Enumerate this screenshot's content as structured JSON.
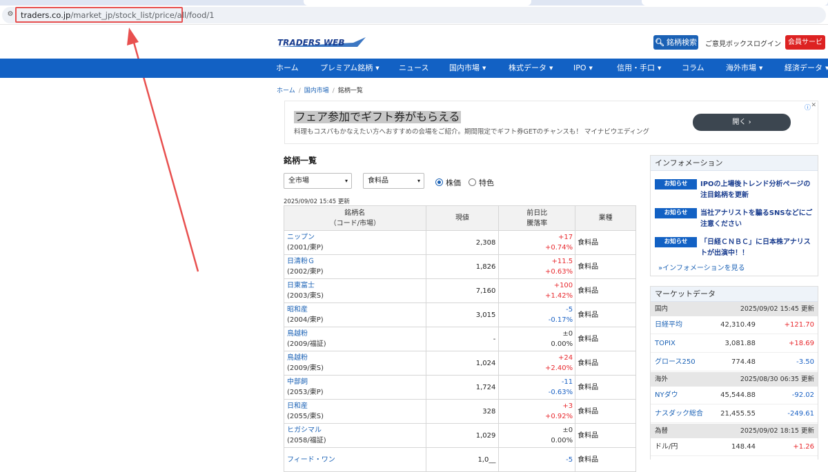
{
  "browser": {
    "url_domain": "traders.co.jp",
    "url_path": "/market_jp/stock_list/price/all/food/1"
  },
  "header": {
    "logo_text": "TRADERS WEB",
    "search_button": "銘柄検索",
    "feedback_link": "ご意見ボックス",
    "login_link": "ログイン",
    "member_button": "会員サービス"
  },
  "nav": [
    {
      "label": "ホーム",
      "caret": false
    },
    {
      "label": "プレミアム銘柄",
      "caret": true
    },
    {
      "label": "ニュース",
      "caret": false
    },
    {
      "label": "国内市場",
      "caret": true
    },
    {
      "label": "株式データ",
      "caret": true
    },
    {
      "label": "IPO",
      "caret": true
    },
    {
      "label": "信用・手口",
      "caret": true
    },
    {
      "label": "コラム",
      "caret": false
    },
    {
      "label": "海外市場",
      "caret": true
    },
    {
      "label": "経済データ",
      "caret": true
    }
  ],
  "breadcrumb": {
    "home": "ホーム",
    "domestic": "国内市場",
    "current": "銘柄一覧",
    "separator": "/"
  },
  "ad": {
    "title": "フェア参加でギフト券がもらえる",
    "description": "料理もコスパもかなえたい方へおすすめの会場をご紹介。期間限定でギフト券GETのチャンスも！ マイナビウエディング",
    "button": "開く",
    "button_icon": "chevron-right-icon",
    "info_icon": "info-icon",
    "close_icon": "close-icon"
  },
  "main": {
    "title": "銘柄一覧",
    "market_select": "全市場",
    "industry_select": "食料品",
    "radio_price": "株価",
    "radio_feature": "特色",
    "updated": "2025/09/02 15:45 更新",
    "columns": {
      "name_line1": "銘柄名",
      "name_line2": "（コード/市場）",
      "price": "現値",
      "change_line1": "前日比",
      "change_line2": "騰落率",
      "industry": "業種"
    },
    "rows": [
      {
        "name": "ニップン",
        "code": "(2001/東P)",
        "price": "2,308",
        "change": "+17",
        "pct": "+0.74%",
        "dir": "up",
        "industry": "食料品"
      },
      {
        "name": "日清粉Ｇ",
        "code": "(2002/東P)",
        "price": "1,826",
        "change": "+11.5",
        "pct": "+0.63%",
        "dir": "up",
        "industry": "食料品"
      },
      {
        "name": "日東富士",
        "code": "(2003/東S)",
        "price": "7,160",
        "change": "+100",
        "pct": "+1.42%",
        "dir": "up",
        "industry": "食料品"
      },
      {
        "name": "昭和産",
        "code": "(2004/東P)",
        "price": "3,015",
        "change": "-5",
        "pct": "-0.17%",
        "dir": "down",
        "industry": "食料品"
      },
      {
        "name": "鳥越粉",
        "code": "(2009/福証)",
        "price": "-",
        "change": "±0",
        "pct": "0.00%",
        "dir": "flat",
        "industry": "食料品"
      },
      {
        "name": "鳥越粉",
        "code": "(2009/東S)",
        "price": "1,024",
        "change": "+24",
        "pct": "+2.40%",
        "dir": "up",
        "industry": "食料品"
      },
      {
        "name": "中部飼",
        "code": "(2053/東P)",
        "price": "1,724",
        "change": "-11",
        "pct": "-0.63%",
        "dir": "down",
        "industry": "食料品"
      },
      {
        "name": "日和産",
        "code": "(2055/東S)",
        "price": "328",
        "change": "+3",
        "pct": "+0.92%",
        "dir": "up",
        "industry": "食料品"
      },
      {
        "name": "ヒガシマル",
        "code": "(2058/福証)",
        "price": "1,029",
        "change": "±0",
        "pct": "0.00%",
        "dir": "flat",
        "industry": "食料品"
      },
      {
        "name": "フィード・ワン",
        "code": "",
        "price": "1,0__",
        "change": "-5",
        "pct": "",
        "dir": "down",
        "industry": "食料品"
      }
    ]
  },
  "sidebar": {
    "info_title": "インフォメーション",
    "info_items": [
      {
        "badge": "お知らせ",
        "text": "IPOの上場後トレンド分析ページの注目銘柄を更新"
      },
      {
        "badge": "お知らせ",
        "text": "当社アナリストを騙るSNSなどにご注意ください"
      },
      {
        "badge": "お知らせ",
        "text": "「日経ＣＮＢＣ」に日本株アナリストが出演中！！"
      }
    ],
    "info_more": "»インフォメーションを見る",
    "market_title": "マーケットデータ",
    "market_sections": [
      {
        "label": "国内",
        "updated": "2025/09/02 15:45 更新",
        "rows": [
          {
            "name": "日経平均",
            "value": "42,310.49",
            "change": "+121.70",
            "dir": "up",
            "link": true
          },
          {
            "name": "TOPIX",
            "value": "3,081.88",
            "change": "+18.69",
            "dir": "up",
            "link": true
          },
          {
            "name": "グロース250",
            "value": "774.48",
            "change": "-3.50",
            "dir": "down",
            "link": true
          }
        ]
      },
      {
        "label": "海外",
        "updated": "2025/08/30 06:35 更新",
        "rows": [
          {
            "name": "NYダウ",
            "value": "45,544.88",
            "change": "-92.02",
            "dir": "down",
            "link": true
          },
          {
            "name": "ナスダック総合",
            "value": "21,455.55",
            "change": "-249.61",
            "dir": "down",
            "link": true
          }
        ]
      },
      {
        "label": "為替",
        "updated": "2025/09/02 18:15 更新",
        "rows": [
          {
            "name": "ドル/円",
            "value": "148.44",
            "change": "+1.26",
            "dir": "up",
            "link": false
          }
        ]
      }
    ]
  },
  "colors": {
    "brand_blue": "#1261c4",
    "member_red": "#dd2222",
    "up": "#e8282d",
    "down": "#1a61c4",
    "annotation": "#e8504f"
  }
}
